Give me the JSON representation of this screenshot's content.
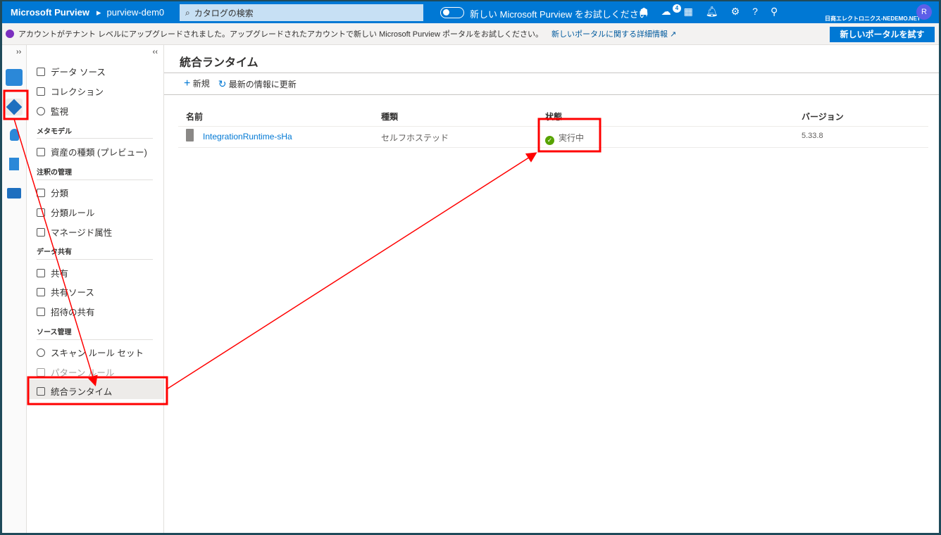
{
  "topbar": {
    "brand": "Microsoft Purview",
    "account": "purview-dem0",
    "search_placeholder": "カタログの検索",
    "try_new": "新しい Microsoft Purview をお試しください",
    "notification_count": "4",
    "tenant": "日商エレクトロニクス-NEDEMO.NET",
    "avatar": "R"
  },
  "banner": {
    "message": "アカウントがテナント レベルにアップグレードされました。アップグレードされたアカウントで新しい Microsoft Purview ポータルをお試しください。",
    "link": "新しいポータルに関する詳細情報 ↗",
    "button": "新しいポータルを試す"
  },
  "rail": {
    "expand": "››"
  },
  "nav": {
    "collapse": "‹‹",
    "items": [
      {
        "label": "データ ソース"
      },
      {
        "label": "コレクション"
      },
      {
        "label": "監視"
      },
      {
        "section": "メタモデル"
      },
      {
        "label": "資産の種類 (プレビュー)"
      },
      {
        "section": "注釈の管理"
      },
      {
        "label": "分類"
      },
      {
        "label": "分類ルール"
      },
      {
        "label": "マネージド属性"
      },
      {
        "section": "データ共有"
      },
      {
        "label": "共有"
      },
      {
        "label": "共有ソース"
      },
      {
        "label": "招待の共有"
      },
      {
        "section": "ソース管理"
      },
      {
        "label": "スキャン ルール セット"
      },
      {
        "label": "パターン ルール"
      },
      {
        "label": "統合ランタイム"
      }
    ]
  },
  "main": {
    "title": "統合ランタイム",
    "toolbar": {
      "new": "新規",
      "refresh": "最新の情報に更新"
    },
    "columns": [
      "名前",
      "種類",
      "状態",
      "バージョン"
    ],
    "rows": [
      {
        "name": "IntegrationRuntime-sHa",
        "type": "セルフホステッド",
        "status": "実行中",
        "version": "5.33.8"
      }
    ]
  },
  "colors": {
    "accent": "#0078d4",
    "annotation": "#ff0000",
    "ok": "#57a300"
  }
}
